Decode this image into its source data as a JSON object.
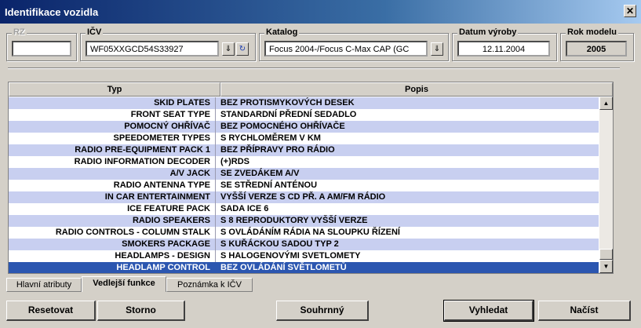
{
  "window": {
    "title": "Identifikace vozidla",
    "close_glyph": "✕"
  },
  "fields": {
    "rz": {
      "label": "RZ",
      "value": ""
    },
    "icv": {
      "label": "IČV",
      "value": "WF05XXGCD54S33927",
      "dropdown_icon": "⇓",
      "refresh_icon": "↻"
    },
    "katalog": {
      "label": "Katalog",
      "value": "Focus 2004-/Focus C-Max CAP (GC",
      "dropdown_icon": "⇓"
    },
    "datum_vyroby": {
      "label": "Datum výroby",
      "value": "12.11.2004"
    },
    "rok_modelu": {
      "label": "Rok modelu",
      "value": "2005"
    }
  },
  "grid": {
    "columns": [
      "Typ",
      "Popis"
    ],
    "scroll_up_icon": "▲",
    "scroll_down_icon": "▼",
    "rows": [
      {
        "typ": "SKID PLATES",
        "popis": "BEZ PROTISMYKOVÝCH DESEK"
      },
      {
        "typ": "FRONT SEAT TYPE",
        "popis": "STANDARDNÍ PŘEDNÍ SEDADLO"
      },
      {
        "typ": "POMOCNÝ OHŘÍVAČ",
        "popis": "BEZ POMOCNÉHO OHŘÍVAČE"
      },
      {
        "typ": "SPEEDOMETER TYPES",
        "popis": "S RYCHLOMĚREM V KM"
      },
      {
        "typ": "RADIO PRE-EQUIPMENT PACK 1",
        "popis": "BEZ PŘÍPRAVY PRO RÁDIO"
      },
      {
        "typ": "RADIO INFORMATION DECODER",
        "popis": "(+)RDS"
      },
      {
        "typ": "A/V JACK",
        "popis": "SE ZVEDÁKEM A/V"
      },
      {
        "typ": "RADIO ANTENNA TYPE",
        "popis": "SE STŘEDNÍ ANTÉNOU"
      },
      {
        "typ": "IN CAR ENTERTAINMENT",
        "popis": "VYŠŠÍ VERZE S CD PŘ. A AM/FM RÁDIO"
      },
      {
        "typ": "ICE FEATURE PACK",
        "popis": "SADA ICE 6"
      },
      {
        "typ": "RADIO SPEAKERS",
        "popis": "S 8 REPRODUKTORY VYŠŠÍ VERZE"
      },
      {
        "typ": "RADIO CONTROLS - COLUMN STALK",
        "popis": "S OVLÁDÁNÍM RÁDIA NA SLOUPKU ŘÍZENÍ"
      },
      {
        "typ": "SMOKERS PACKAGE",
        "popis": "S KUŘÁCKOU SADOU TYP 2"
      },
      {
        "typ": "HEADLAMPS - DESIGN",
        "popis": "S HALOGENOVÝMI SVETLOMETY"
      },
      {
        "typ": "HEADLAMP CONTROL",
        "popis": "BEZ OVLÁDÁNÍ SVĚTLOMETŮ"
      }
    ]
  },
  "tabs": [
    "Hlavní atributy",
    "Vedlejší funkce",
    "Poznámka k IČV"
  ],
  "buttons": {
    "resetovat": "Resetovat",
    "storno": "Storno",
    "souhrnny": "Souhrnný",
    "vyhledat": "Vyhledat",
    "nacist": "Načíst"
  },
  "colors": {
    "row_odd": "#c8cff0",
    "row_even": "#ffffff",
    "row_selected": "#2b56b0"
  }
}
